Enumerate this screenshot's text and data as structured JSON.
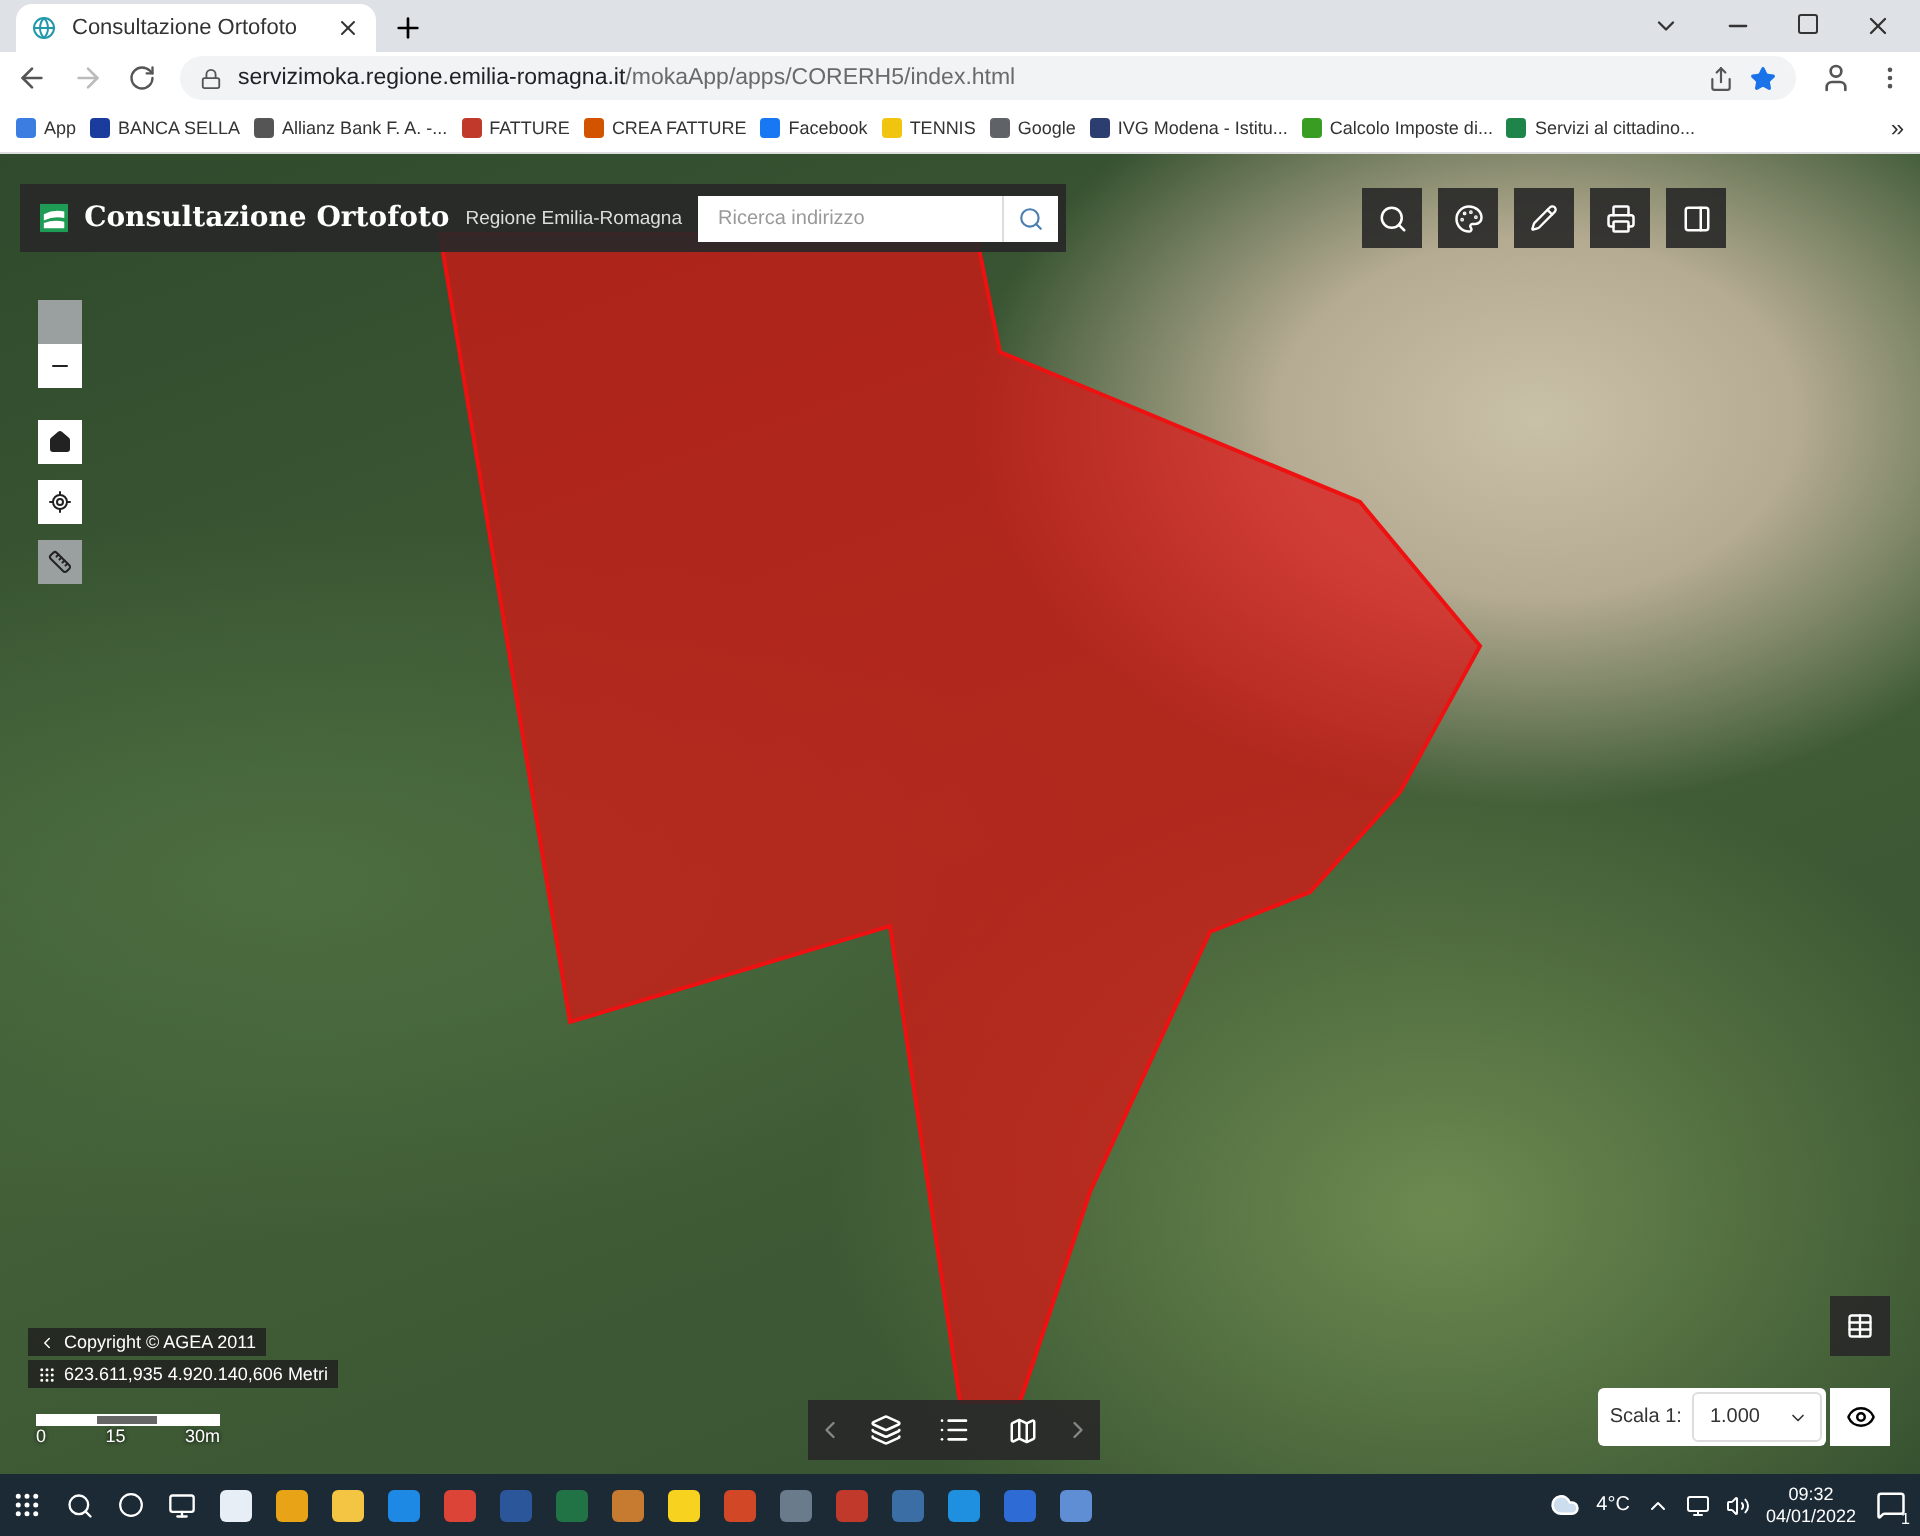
{
  "browser": {
    "tab": {
      "title": "Consultazione Ortofoto",
      "selected": true
    },
    "url": {
      "host": "servizimoka.regione.emilia-romagna.it",
      "path": "/mokaApp/apps/CORERH5/index.html"
    },
    "bookmarks": [
      {
        "label": "App",
        "color": "#3b7de0"
      },
      {
        "label": "BANCA SELLA",
        "color": "#1a3c9c"
      },
      {
        "label": "Allianz Bank F. A. -...",
        "color": "#555555"
      },
      {
        "label": "FATTURE",
        "color": "#c0392b"
      },
      {
        "label": "CREA FATTURE",
        "color": "#d35400"
      },
      {
        "label": "Facebook",
        "color": "#1877f2"
      },
      {
        "label": "TENNIS",
        "color": "#f1c40f"
      },
      {
        "label": "Google",
        "color": "#5f6368"
      },
      {
        "label": "IVG Modena - Istitu...",
        "color": "#2c3e70"
      },
      {
        "label": "Calcolo Imposte di...",
        "color": "#3a9d23"
      },
      {
        "label": "Servizi al cittadino...",
        "color": "#1e8449"
      }
    ],
    "more": "»"
  },
  "app": {
    "title": "Consultazione Ortofoto",
    "subtitle": "Regione Emilia-Romagna",
    "search": {
      "placeholder": "Ricerca indirizzo"
    },
    "copyright": "Copyright © AGEA 2011",
    "coordinates": "623.611,935 4.920.140,606 Metri",
    "scalebar": [
      "0",
      "15",
      "30m"
    ],
    "scale": {
      "label": "Scala 1:",
      "value": "1.000"
    }
  },
  "taskbar": {
    "temperature": "4°C",
    "time": "09:32",
    "date": "04/01/2022",
    "notifications": "1"
  }
}
